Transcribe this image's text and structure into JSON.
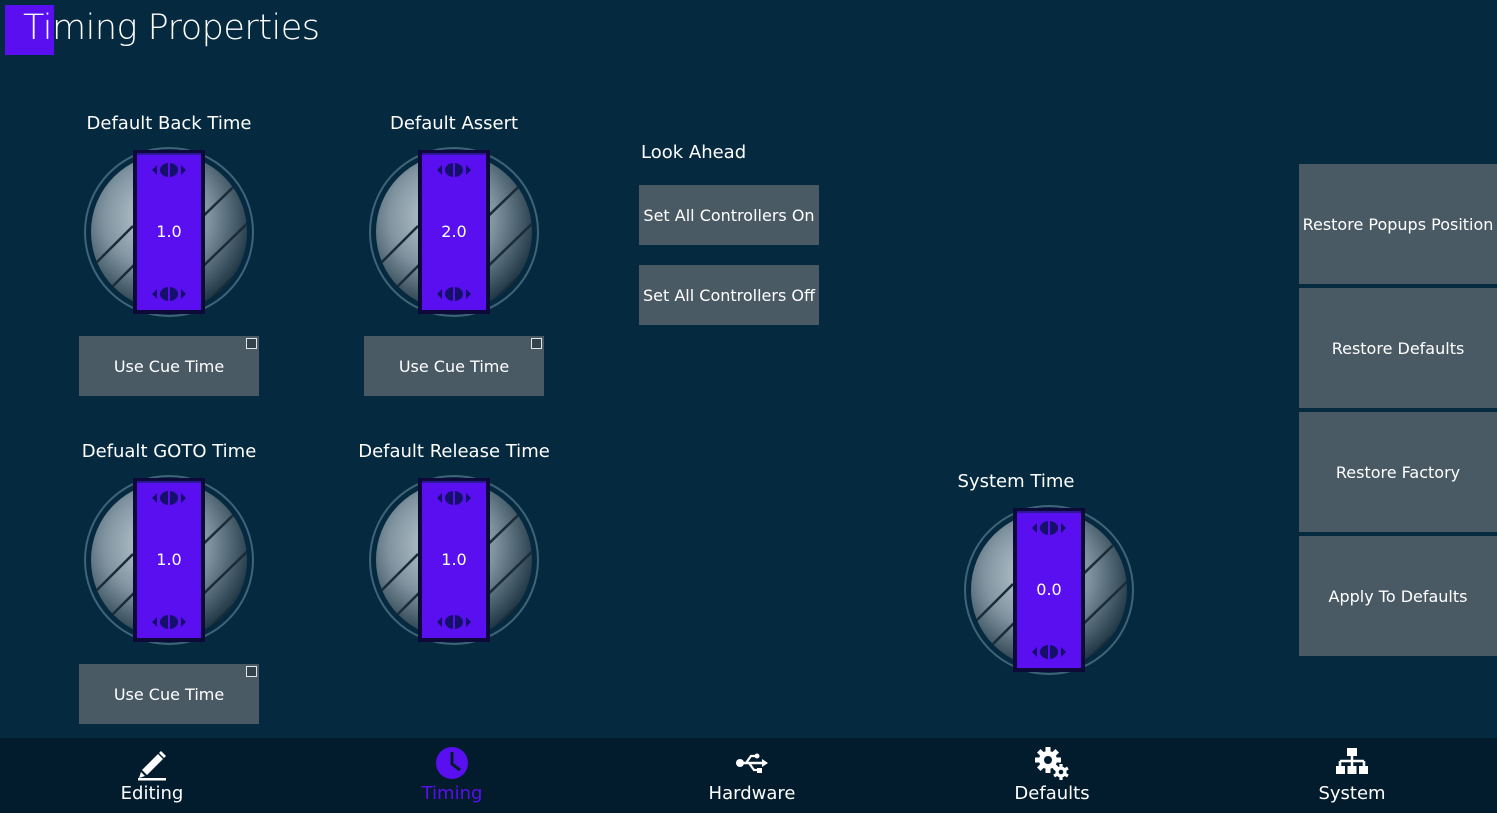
{
  "colors": {
    "accent": "#5a0ff0",
    "background": "#052a40",
    "button": "#4a5a64",
    "bottom_bar": "#021c2d"
  },
  "page": {
    "title": "Timing Properties"
  },
  "dials": {
    "back_time": {
      "label": "Default Back Time",
      "value": "1.0"
    },
    "assert": {
      "label": "Default Assert",
      "value": "2.0"
    },
    "goto_time": {
      "label": "Defualt GOTO Time",
      "value": "1.0"
    },
    "release_time": {
      "label": "Default Release Time",
      "value": "1.0"
    },
    "system_time": {
      "label": "System Time",
      "value": "0.0"
    }
  },
  "cue_buttons": {
    "back_time": "Use Cue Time",
    "assert": "Use Cue Time",
    "goto_time": "Use Cue Time"
  },
  "look_ahead": {
    "label": "Look Ahead",
    "on_button": "Set All Controllers On",
    "off_button": "Set All Controllers Off"
  },
  "side_buttons": {
    "restore_popups": "Restore Popups Position",
    "restore_defaults": "Restore Defaults",
    "restore_factory": "Restore Factory",
    "apply_to_defaults": "Apply To Defaults"
  },
  "nav": {
    "items": [
      {
        "label": "Editing",
        "icon": "pencil-icon"
      },
      {
        "label": "Timing",
        "icon": "clock-icon",
        "active": true
      },
      {
        "label": "Hardware",
        "icon": "usb-icon"
      },
      {
        "label": "Defaults",
        "icon": "gears-icon"
      },
      {
        "label": "System",
        "icon": "network-icon"
      }
    ]
  }
}
